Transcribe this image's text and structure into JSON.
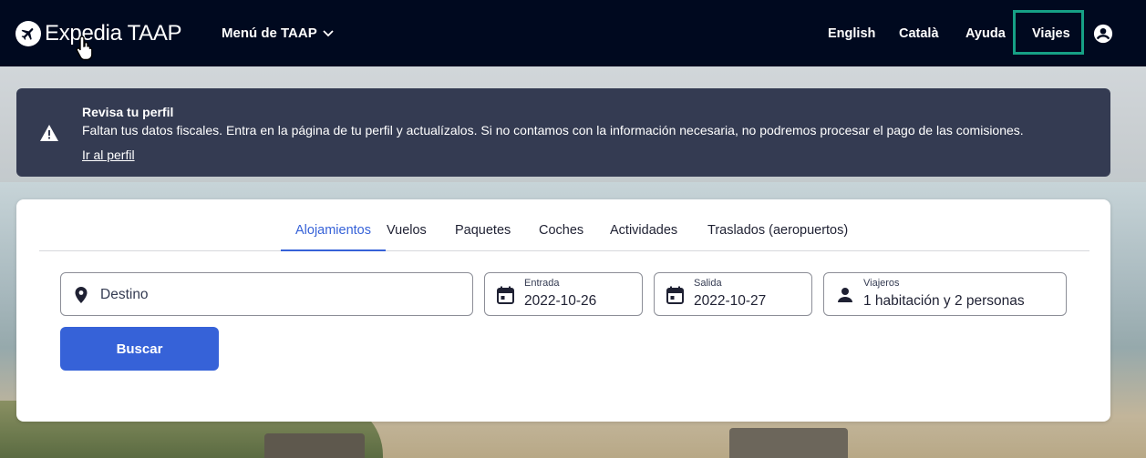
{
  "header": {
    "logo_text": "Expedia TAAP",
    "menu_label": "Menú de TAAP",
    "nav": {
      "english": "English",
      "catala": "Català",
      "ayuda": "Ayuda",
      "viajes": "Viajes"
    }
  },
  "alert": {
    "title": "Revisa tu perfil",
    "body": "Faltan tus datos fiscales. Entra en la página de tu perfil y actualízalos. Si no contamos con la información necesaria, no podremos procesar el pago de las comisiones.",
    "link": "Ir al perfil"
  },
  "search": {
    "tabs": [
      "Alojamientos",
      "Vuelos",
      "Paquetes",
      "Coches",
      "Actividades",
      "Traslados (aeropuertos)"
    ],
    "active_tab": "Alojamientos",
    "destination_placeholder": "Destino",
    "checkin": {
      "label": "Entrada",
      "value": "2022-10-26"
    },
    "checkout": {
      "label": "Salida",
      "value": "2022-10-27"
    },
    "travelers": {
      "label": "Viajeros",
      "value": "1 habitación y 2 personas"
    },
    "submit_label": "Buscar"
  },
  "colors": {
    "header_bg": "#00091f",
    "alert_bg": "#343b52",
    "accent": "#3662d8",
    "highlight": "#16a085"
  },
  "icons": [
    "plane-logo-icon",
    "chevron-down-icon",
    "account-icon",
    "warning-icon",
    "location-pin-icon",
    "calendar-icon",
    "person-icon",
    "hand-cursor-icon"
  ]
}
